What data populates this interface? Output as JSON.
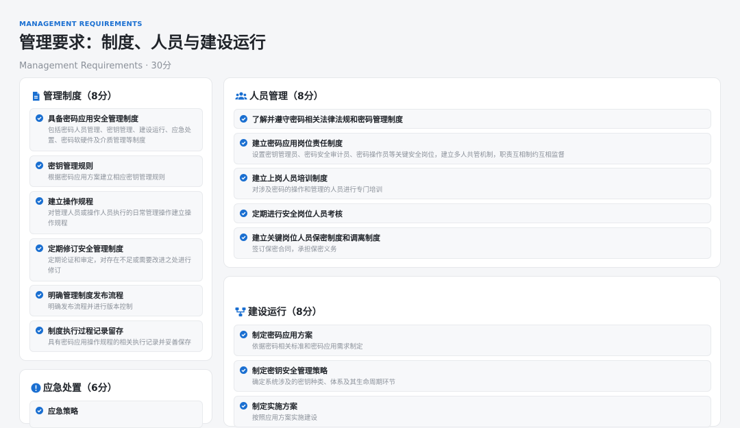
{
  "header": {
    "eyebrow": "MANAGEMENT REQUIREMENTS",
    "title": "管理要求：制度、人员与建设运行",
    "subtitle": "Management Requirements · 30分"
  },
  "colors": {
    "accent": "#1a6fd1",
    "muted": "#8a9099"
  },
  "cards": {
    "policy": {
      "icon": "document-icon",
      "title": "管理制度（8分）",
      "items": [
        {
          "title": "具备密码应用安全管理制度",
          "desc": "包括密码人员管理、密钥管理、建设运行、应急处置、密码软硬件及介质管理等制度"
        },
        {
          "title": "密钥管理规则",
          "desc": "根据密码应用方案建立相应密钥管理规则"
        },
        {
          "title": "建立操作规程",
          "desc": "对管理人员或操作人员执行的日常管理操作建立操作规程"
        },
        {
          "title": "定期修订安全管理制度",
          "desc": "定期论证和审定，对存在不足或需要改进之处进行修订"
        },
        {
          "title": "明确管理制度发布流程",
          "desc": "明确发布流程并进行版本控制"
        },
        {
          "title": "制度执行过程记录留存",
          "desc": "具有密码应用操作规程的相关执行记录并妥善保存"
        }
      ]
    },
    "emergency": {
      "icon": "alert-icon",
      "title": "应急处置（6分）",
      "items": [
        {
          "title": "应急策略"
        }
      ]
    },
    "personnel": {
      "icon": "people-icon",
      "title": "人员管理（8分）",
      "items": [
        {
          "title": "了解并遵守密码相关法律法规和密码管理制度"
        },
        {
          "title": "建立密码应用岗位责任制度",
          "desc": "设置密钥管理员、密码安全审计员、密码操作员等关键安全岗位，建立多人共管机制，职责互相制约互相监督"
        },
        {
          "title": "建立上岗人员培训制度",
          "desc": "对涉及密码的操作和管理的人员进行专门培训"
        },
        {
          "title": "定期进行安全岗位人员考核"
        },
        {
          "title": "建立关键岗位人员保密制度和调离制度",
          "desc": "签订保密合同，承担保密义务"
        }
      ]
    },
    "operation": {
      "icon": "network-icon",
      "title": "建设运行（8分）",
      "items": [
        {
          "title": "制定密码应用方案",
          "desc": "依据密码相关标准和密码应用需求制定"
        },
        {
          "title": "制定密钥安全管理策略",
          "desc": "确定系统涉及的密钥种类、体系及其生命周期环节"
        },
        {
          "title": "制定实施方案",
          "desc": "按照应用方案实施建设"
        }
      ]
    }
  }
}
